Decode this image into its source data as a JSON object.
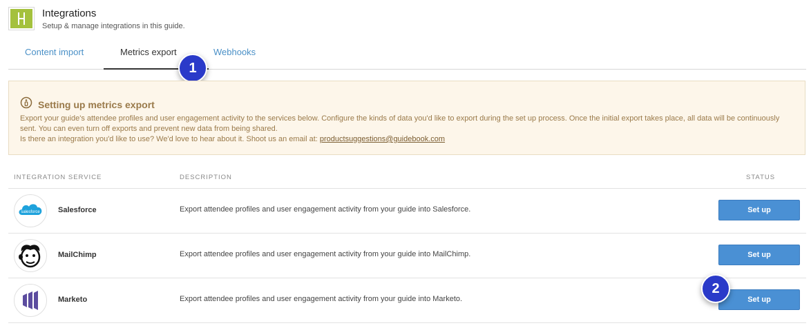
{
  "header": {
    "title": "Integrations",
    "subtitle": "Setup & manage integrations in this guide."
  },
  "tabs": [
    {
      "label": "Content import",
      "active": false
    },
    {
      "label": "Metrics export",
      "active": true
    },
    {
      "label": "Webhooks",
      "active": false
    }
  ],
  "badges": [
    "1",
    "2"
  ],
  "notice": {
    "title": "Setting up metrics export",
    "line1": "Export your guide's attendee profiles and user engagement activity to the services below. Configure the kinds of data you'd like to export during the set up process. Once the initial export takes place, all data will be continuously sent. You can even turn off exports and prevent new data from being shared.",
    "line2_prefix": "Is there an integration you'd like to use? We'd love to hear about it. Shoot us an email at: ",
    "email": "productsuggestions@guidebook.com"
  },
  "table": {
    "headers": {
      "service": "Integration Service",
      "description": "Description",
      "status": "Status"
    },
    "rows": [
      {
        "name": "Salesforce",
        "logo_text": "salesforce",
        "description": "Export attendee profiles and user engagement activity from your guide into Salesforce.",
        "button": "Set up"
      },
      {
        "name": "MailChimp",
        "description": "Export attendee profiles and user engagement activity from your guide into MailChimp.",
        "button": "Set up"
      },
      {
        "name": "Marketo",
        "description": "Export attendee profiles and user engagement activity from your guide into Marketo.",
        "button": "Set up"
      }
    ]
  },
  "colors": {
    "accent": "#4a90d4",
    "tab_link": "#4a90c7",
    "notice_bg": "#fdf6ea",
    "notice_text": "#9a7a4a",
    "badge": "#2a3ac9",
    "app_icon": "#a4c13d",
    "salesforce": "#1ea2dc",
    "marketo": "#5c4c9f"
  }
}
